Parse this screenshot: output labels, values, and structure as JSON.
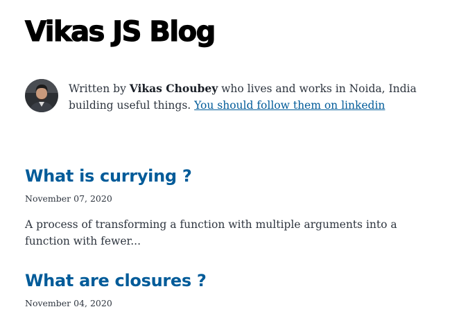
{
  "site": {
    "title": "Vikas JS Blog"
  },
  "bio": {
    "prefix": "Written by ",
    "author": "Vikas Choubey",
    "middle": " who lives and works in Noida, India building useful things. ",
    "link_text": "You should follow them on linkedin"
  },
  "posts": [
    {
      "title": "What is currying ?",
      "date": "November 07, 2020",
      "excerpt": "A process of transforming a function with multiple arguments into a function with fewer..."
    },
    {
      "title": "What are closures ?",
      "date": "November 04, 2020"
    }
  ],
  "colors": {
    "link": "#005b99",
    "text": "#2e353f",
    "title": "#000000"
  }
}
